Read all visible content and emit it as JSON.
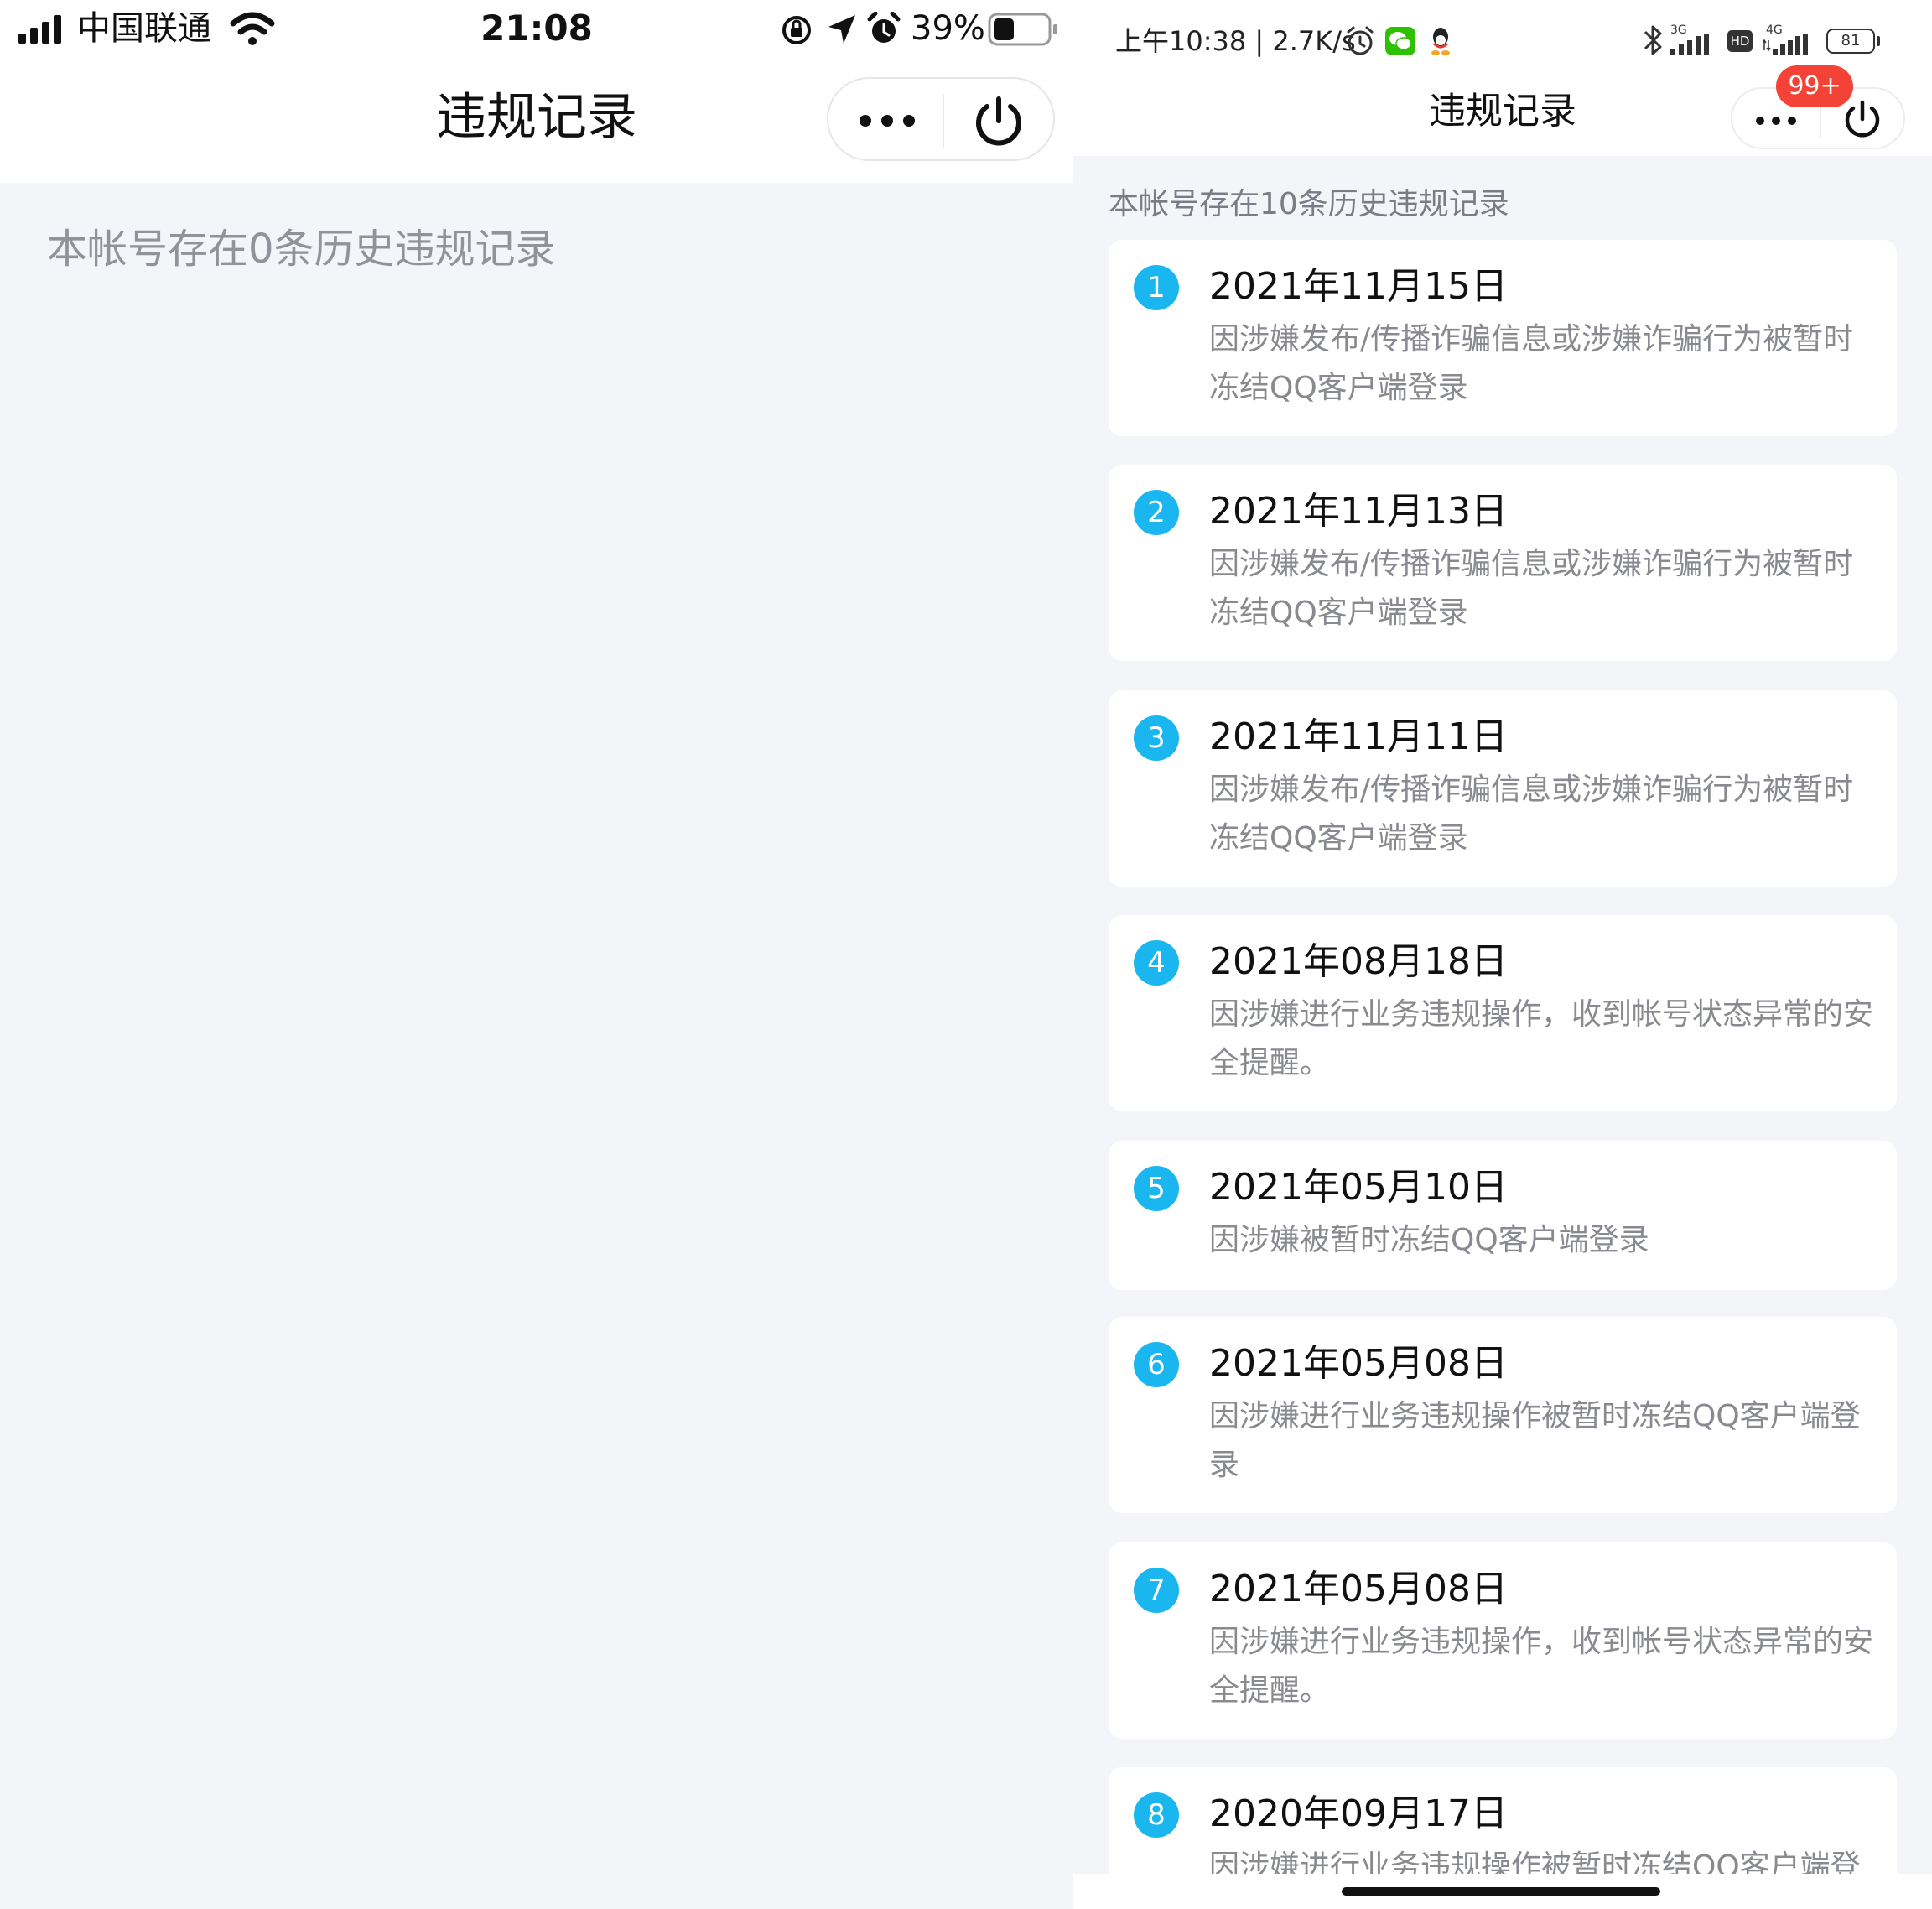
{
  "left": {
    "statusbar": {
      "carrier": "中国联通",
      "time": "21:08",
      "battery_percent": "39%",
      "battery_level": 0.39,
      "icons": [
        "signal-icon",
        "wifi-icon",
        "rotation-lock-icon",
        "location-icon",
        "alarm-icon",
        "battery-icon"
      ]
    },
    "title": "违规记录",
    "capsule": {
      "more_icon": "more-dots-icon",
      "close_icon": "power-icon"
    },
    "summary": "本帐号存在0条历史违规记录"
  },
  "right": {
    "statusbar": {
      "text": "上午10:38 | 2.7K/s",
      "network_3g": "3G",
      "network_4g": "4G",
      "hd": "HD",
      "battery": "81",
      "icons": [
        "alarm-icon",
        "wechat-icon",
        "qq-icon",
        "bluetooth-icon",
        "signal-icon",
        "hd-icon",
        "battery-icon"
      ]
    },
    "title": "违规记录",
    "badge": "99+",
    "capsule": {
      "more_icon": "more-dots-icon",
      "close_icon": "power-icon"
    },
    "summary": "本帐号存在10条历史违规记录",
    "records": [
      {
        "num": "1",
        "date": "2021年11月15日",
        "desc": "因涉嫌发布/传播诈骗信息或涉嫌诈骗行为被暂时冻结QQ客户端登录"
      },
      {
        "num": "2",
        "date": "2021年11月13日",
        "desc": "因涉嫌发布/传播诈骗信息或涉嫌诈骗行为被暂时冻结QQ客户端登录"
      },
      {
        "num": "3",
        "date": "2021年11月11日",
        "desc": "因涉嫌发布/传播诈骗信息或涉嫌诈骗行为被暂时冻结QQ客户端登录"
      },
      {
        "num": "4",
        "date": "2021年08月18日",
        "desc": "因涉嫌进行业务违规操作，收到帐号状态异常的安全提醒。"
      },
      {
        "num": "5",
        "date": "2021年05月10日",
        "desc": "因涉嫌被暂时冻结QQ客户端登录"
      },
      {
        "num": "6",
        "date": "2021年05月08日",
        "desc": "因涉嫌进行业务违规操作被暂时冻结QQ客户端登录"
      },
      {
        "num": "7",
        "date": "2021年05月08日",
        "desc": "因涉嫌进行业务违规操作，收到帐号状态异常的安全提醒。"
      },
      {
        "num": "8",
        "date": "2020年09月17日",
        "desc": "因涉嫌进行业务违规操作被暂时冻结QQ客户端登"
      }
    ]
  },
  "colors": {
    "page_bg": "#f4f5f9",
    "accent_number": "#1ab6ef",
    "badge": "#f44336",
    "summary_text": "#909399"
  }
}
